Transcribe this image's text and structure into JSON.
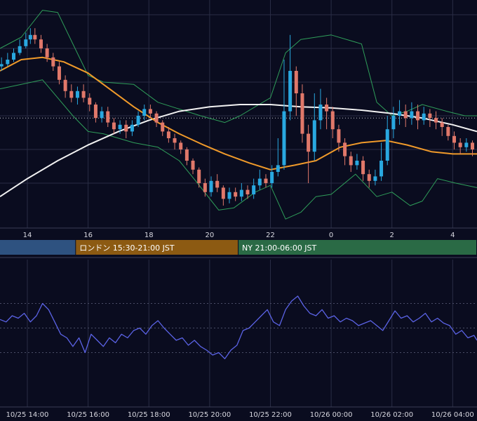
{
  "chart_data": [
    {
      "type": "candlestick",
      "panel": "price",
      "ylim": [
        0,
        100
      ],
      "x_ticks": [
        "14",
        "16",
        "18",
        "20",
        "22",
        "0",
        "2",
        "4"
      ],
      "x_range_hours": [
        13.1,
        28.8
      ],
      "colors": {
        "up": "#29a8e0",
        "down": "#e0786a",
        "grid": "#2a2d45",
        "background": "#0a0c1f"
      },
      "reference_line": {
        "style": "dotted",
        "value": 49,
        "color": "#c8c8d0"
      },
      "indicators": [
        {
          "kind": "bollinger_bands",
          "color": "#2f9e5a"
        },
        {
          "kind": "moving_average",
          "color": "#f09a2a"
        },
        {
          "kind": "moving_average",
          "color": "#f2f2f2"
        }
      ],
      "sessions": [
        {
          "label": "",
          "x_start": 13.1,
          "x_end": 15.6,
          "color": "#2e5280"
        },
        {
          "label": "ロンドン 15:30-21:00 JST",
          "x_start": 15.6,
          "x_end": 20.95,
          "color": "#8c5a12"
        },
        {
          "label": "NY 21:00-06:00 JST",
          "x_start": 20.95,
          "x_end": 28.8,
          "color": "#2a6a45"
        }
      ],
      "ma_long": [
        [
          13.1,
          14
        ],
        [
          14,
          22
        ],
        [
          15,
          30
        ],
        [
          16,
          37
        ],
        [
          17,
          43
        ],
        [
          18,
          48
        ],
        [
          19,
          52
        ],
        [
          20,
          54
        ],
        [
          21,
          55
        ],
        [
          22,
          55
        ],
        [
          23,
          54
        ],
        [
          24,
          53.5
        ],
        [
          25,
          52.5
        ],
        [
          26,
          51
        ],
        [
          27,
          49
        ],
        [
          28,
          46
        ],
        [
          28.8,
          43
        ]
      ],
      "ma_short": [
        [
          13.1,
          70
        ],
        [
          13.8,
          75
        ],
        [
          14.5,
          76
        ],
        [
          15.2,
          74
        ],
        [
          16,
          69
        ],
        [
          16.8,
          61
        ],
        [
          17.5,
          54
        ],
        [
          18.3,
          47
        ],
        [
          19,
          42
        ],
        [
          19.8,
          37
        ],
        [
          20.5,
          33
        ],
        [
          21.3,
          29
        ],
        [
          22,
          26
        ],
        [
          22.8,
          28
        ],
        [
          23.5,
          30
        ],
        [
          24.3,
          36
        ],
        [
          25,
          38
        ],
        [
          25.8,
          39
        ],
        [
          26.5,
          37
        ],
        [
          27.3,
          34
        ],
        [
          28,
          33
        ],
        [
          28.8,
          33
        ]
      ],
      "bb_upper": [
        [
          13.1,
          80
        ],
        [
          13.8,
          85
        ],
        [
          14.5,
          97
        ],
        [
          15,
          96
        ],
        [
          15.5,
          82
        ],
        [
          16,
          68
        ],
        [
          16.5,
          65
        ],
        [
          17.5,
          64
        ],
        [
          18.3,
          56
        ],
        [
          19,
          53
        ],
        [
          19.7,
          50
        ],
        [
          20.5,
          47
        ],
        [
          21,
          50
        ],
        [
          21.5,
          54
        ],
        [
          22,
          58
        ],
        [
          22.5,
          78
        ],
        [
          23,
          84
        ],
        [
          24,
          86
        ],
        [
          25,
          82
        ],
        [
          25.5,
          56
        ],
        [
          26,
          50
        ],
        [
          26.5,
          52
        ],
        [
          27,
          55
        ],
        [
          27.8,
          52
        ],
        [
          28.4,
          50
        ],
        [
          28.8,
          50
        ]
      ],
      "bb_lower": [
        [
          13.1,
          62
        ],
        [
          13.8,
          64
        ],
        [
          14.5,
          66
        ],
        [
          15,
          58
        ],
        [
          15.5,
          50
        ],
        [
          16,
          43
        ],
        [
          16.5,
          42
        ],
        [
          17.5,
          38
        ],
        [
          18.3,
          36
        ],
        [
          19,
          30
        ],
        [
          19.6,
          20
        ],
        [
          20.3,
          8
        ],
        [
          20.8,
          9
        ],
        [
          21.5,
          16
        ],
        [
          22,
          19
        ],
        [
          22.5,
          4
        ],
        [
          23,
          7
        ],
        [
          23.5,
          14
        ],
        [
          24,
          15
        ],
        [
          24.8,
          24
        ],
        [
          25.5,
          14
        ],
        [
          26,
          16
        ],
        [
          26.6,
          10
        ],
        [
          27,
          12
        ],
        [
          27.5,
          22
        ],
        [
          28.1,
          20
        ],
        [
          28.8,
          18
        ]
      ],
      "candles": [
        [
          13.15,
          72,
          73,
          76,
          70
        ],
        [
          13.35,
          73,
          75,
          78,
          72
        ],
        [
          13.55,
          75,
          78,
          80,
          74
        ],
        [
          13.75,
          78,
          81,
          84,
          77
        ],
        [
          13.95,
          81,
          84,
          87,
          80
        ],
        [
          14.1,
          84,
          86,
          89,
          82
        ],
        [
          14.25,
          86,
          84,
          89,
          82
        ],
        [
          14.45,
          84,
          80,
          86,
          78
        ],
        [
          14.65,
          80,
          76,
          82,
          74
        ],
        [
          14.85,
          76,
          72,
          78,
          70
        ],
        [
          15.05,
          72,
          66,
          74,
          64
        ],
        [
          15.25,
          66,
          61,
          68,
          58
        ],
        [
          15.45,
          61,
          58,
          64,
          56
        ],
        [
          15.65,
          58,
          61,
          63,
          55
        ],
        [
          15.85,
          61,
          58,
          64,
          56
        ],
        [
          16.05,
          58,
          55,
          60,
          52
        ],
        [
          16.25,
          55,
          49,
          56,
          47
        ],
        [
          16.45,
          49,
          52,
          54,
          47
        ],
        [
          16.65,
          52,
          47,
          54,
          45
        ],
        [
          16.85,
          47,
          44,
          49,
          42
        ],
        [
          17.05,
          44,
          46,
          48,
          42
        ],
        [
          17.25,
          46,
          43,
          48,
          40
        ],
        [
          17.45,
          43,
          46,
          48,
          41
        ],
        [
          17.65,
          46,
          50,
          52,
          45
        ],
        [
          17.85,
          50,
          53,
          55,
          48
        ],
        [
          18.05,
          53,
          51,
          55,
          49
        ],
        [
          18.25,
          51,
          47,
          52,
          45
        ],
        [
          18.45,
          47,
          43,
          48,
          41
        ],
        [
          18.65,
          43,
          40,
          45,
          38
        ],
        [
          18.85,
          40,
          38,
          42,
          35
        ],
        [
          19.05,
          38,
          35,
          39,
          33
        ],
        [
          19.25,
          35,
          30,
          36,
          28
        ],
        [
          19.45,
          30,
          26,
          31,
          24
        ],
        [
          19.65,
          26,
          20,
          27,
          18
        ],
        [
          19.85,
          20,
          16,
          22,
          14
        ],
        [
          20.05,
          16,
          21,
          23,
          14
        ],
        [
          20.25,
          21,
          18,
          24,
          16
        ],
        [
          20.45,
          18,
          13,
          19,
          10
        ],
        [
          20.65,
          13,
          16,
          18,
          11
        ],
        [
          20.85,
          16,
          14,
          18,
          12
        ],
        [
          21.05,
          14,
          17,
          20,
          12
        ],
        [
          21.25,
          17,
          15,
          19,
          13
        ],
        [
          21.45,
          15,
          19,
          22,
          13
        ],
        [
          21.65,
          19,
          22,
          26,
          17
        ],
        [
          21.85,
          22,
          20,
          24,
          18
        ],
        [
          22.05,
          20,
          25,
          28,
          18
        ],
        [
          22.25,
          25,
          28,
          40,
          23
        ],
        [
          22.45,
          28,
          52,
          75,
          26
        ],
        [
          22.65,
          52,
          70,
          86,
          48
        ],
        [
          22.85,
          70,
          60,
          72,
          50
        ],
        [
          23.05,
          60,
          42,
          64,
          38
        ],
        [
          23.25,
          42,
          34,
          46,
          20
        ],
        [
          23.45,
          34,
          48,
          60,
          30
        ],
        [
          23.65,
          48,
          55,
          62,
          44
        ],
        [
          23.85,
          55,
          52,
          58,
          44
        ],
        [
          24.05,
          52,
          44,
          54,
          40
        ],
        [
          24.25,
          44,
          38,
          46,
          34
        ],
        [
          24.45,
          38,
          32,
          40,
          28
        ],
        [
          24.65,
          32,
          28,
          34,
          25
        ],
        [
          24.85,
          28,
          30,
          33,
          26
        ],
        [
          25.05,
          30,
          24,
          32,
          21
        ],
        [
          25.25,
          24,
          21,
          26,
          18
        ],
        [
          25.45,
          21,
          23,
          26,
          19
        ],
        [
          25.65,
          23,
          30,
          38,
          21
        ],
        [
          25.85,
          30,
          44,
          50,
          28
        ],
        [
          26.05,
          44,
          50,
          54,
          40
        ],
        [
          26.25,
          50,
          52,
          57,
          46
        ],
        [
          26.45,
          52,
          49,
          55,
          45
        ],
        [
          26.65,
          49,
          52,
          56,
          46
        ],
        [
          26.85,
          52,
          48,
          55,
          44
        ],
        [
          27.05,
          48,
          51,
          54,
          46
        ],
        [
          27.25,
          51,
          49,
          53,
          45
        ],
        [
          27.45,
          49,
          47,
          52,
          44
        ],
        [
          27.65,
          47,
          45,
          49,
          41
        ],
        [
          27.85,
          45,
          41,
          46,
          39
        ],
        [
          28.05,
          41,
          38,
          43,
          35
        ],
        [
          28.25,
          38,
          36,
          40,
          33
        ],
        [
          28.45,
          36,
          38,
          40,
          34
        ],
        [
          28.65,
          38,
          35,
          39,
          32
        ]
      ]
    },
    {
      "type": "line",
      "panel": "oscillator",
      "ylim": [
        0,
        100
      ],
      "x_range_hours": [
        13.1,
        28.8
      ],
      "x_ticks": [
        "10/25 14:00",
        "10/25 16:00",
        "10/25 18:00",
        "10/25 20:00",
        "10/25 22:00",
        "10/26 00:00",
        "10/26 02:00",
        "10/26 04:00"
      ],
      "color": "#5b63e6",
      "reference_lines": [
        70,
        50,
        30
      ],
      "points": [
        [
          13.1,
          57
        ],
        [
          13.3,
          55
        ],
        [
          13.5,
          60
        ],
        [
          13.7,
          58
        ],
        [
          13.9,
          62
        ],
        [
          14.1,
          55
        ],
        [
          14.3,
          60
        ],
        [
          14.5,
          70
        ],
        [
          14.7,
          65
        ],
        [
          14.9,
          55
        ],
        [
          15.1,
          45
        ],
        [
          15.3,
          42
        ],
        [
          15.5,
          35
        ],
        [
          15.7,
          42
        ],
        [
          15.9,
          30
        ],
        [
          16.1,
          45
        ],
        [
          16.3,
          40
        ],
        [
          16.5,
          35
        ],
        [
          16.7,
          42
        ],
        [
          16.9,
          38
        ],
        [
          17.1,
          45
        ],
        [
          17.3,
          42
        ],
        [
          17.5,
          48
        ],
        [
          17.7,
          50
        ],
        [
          17.9,
          45
        ],
        [
          18.1,
          52
        ],
        [
          18.3,
          56
        ],
        [
          18.5,
          50
        ],
        [
          18.7,
          45
        ],
        [
          18.9,
          40
        ],
        [
          19.1,
          42
        ],
        [
          19.3,
          36
        ],
        [
          19.5,
          40
        ],
        [
          19.7,
          35
        ],
        [
          19.9,
          32
        ],
        [
          20.1,
          28
        ],
        [
          20.3,
          30
        ],
        [
          20.5,
          25
        ],
        [
          20.7,
          32
        ],
        [
          20.9,
          36
        ],
        [
          21.1,
          48
        ],
        [
          21.3,
          50
        ],
        [
          21.5,
          55
        ],
        [
          21.7,
          60
        ],
        [
          21.9,
          65
        ],
        [
          22.1,
          55
        ],
        [
          22.3,
          52
        ],
        [
          22.5,
          65
        ],
        [
          22.7,
          72
        ],
        [
          22.9,
          76
        ],
        [
          23.1,
          68
        ],
        [
          23.3,
          62
        ],
        [
          23.5,
          60
        ],
        [
          23.7,
          65
        ],
        [
          23.9,
          58
        ],
        [
          24.1,
          60
        ],
        [
          24.3,
          55
        ],
        [
          24.5,
          58
        ],
        [
          24.7,
          56
        ],
        [
          24.9,
          52
        ],
        [
          25.1,
          54
        ],
        [
          25.3,
          56
        ],
        [
          25.5,
          52
        ],
        [
          25.7,
          48
        ],
        [
          25.9,
          56
        ],
        [
          26.1,
          64
        ],
        [
          26.3,
          58
        ],
        [
          26.5,
          60
        ],
        [
          26.7,
          55
        ],
        [
          26.9,
          58
        ],
        [
          27.1,
          62
        ],
        [
          27.3,
          55
        ],
        [
          27.5,
          58
        ],
        [
          27.7,
          54
        ],
        [
          27.9,
          52
        ],
        [
          28.1,
          45
        ],
        [
          28.3,
          48
        ],
        [
          28.5,
          42
        ],
        [
          28.7,
          44
        ],
        [
          28.8,
          40
        ]
      ]
    }
  ]
}
